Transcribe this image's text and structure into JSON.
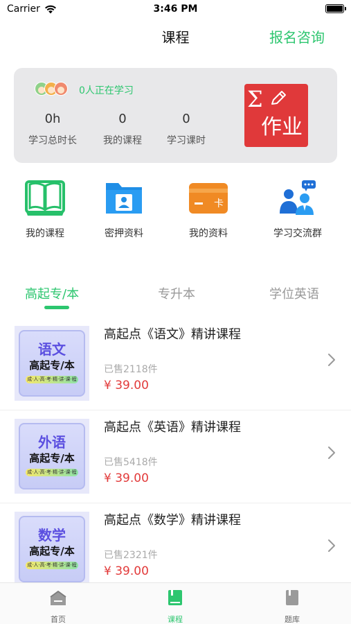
{
  "status_bar": {
    "carrier": "Carrier",
    "time": "3:46 PM"
  },
  "nav": {
    "title": "课程",
    "action": "报名咨询"
  },
  "stats_card": {
    "learning_now": "0人正在学习",
    "stats": [
      {
        "value": "0h",
        "label": "学习总时长"
      },
      {
        "value": "0",
        "label": "我的课程"
      },
      {
        "value": "0",
        "label": "学习课时"
      }
    ],
    "homework_label": "作业",
    "homework_symbol": "Σ"
  },
  "quick_menu": [
    {
      "label": "我的课程",
      "icon": "book-icon"
    },
    {
      "label": "密押资料",
      "icon": "folder-user-icon"
    },
    {
      "label": "我的资料",
      "icon": "card-icon"
    },
    {
      "label": "学习交流群",
      "icon": "group-chat-icon"
    }
  ],
  "tabs": [
    {
      "label": "高起专/本",
      "active": true
    },
    {
      "label": "专升本",
      "active": false
    },
    {
      "label": "学位英语",
      "active": false
    }
  ],
  "courses": [
    {
      "cover_subject": "语文",
      "cover_level": "高起专/本",
      "cover_strip": "成·人·高·考·精·讲·课·程",
      "title": "高起点《语文》精讲课程",
      "sold": "已售2118件",
      "price": "¥ 39.00"
    },
    {
      "cover_subject": "外语",
      "cover_level": "高起专/本",
      "cover_strip": "成·人·高·考·精·讲·课·程",
      "title": "高起点《英语》精讲课程",
      "sold": "已售5418件",
      "price": "¥ 39.00"
    },
    {
      "cover_subject": "数学",
      "cover_level": "高起专/本",
      "cover_strip": "成·人·高·考·精·讲·课·程",
      "title": "高起点《数学》精讲课程",
      "sold": "已售2321件",
      "price": "¥ 39.00"
    }
  ],
  "tabbar": [
    {
      "label": "首页",
      "icon": "home-icon",
      "active": false
    },
    {
      "label": "课程",
      "icon": "course-book-icon",
      "active": true
    },
    {
      "label": "题库",
      "icon": "question-bank-icon",
      "active": false
    }
  ],
  "colors": {
    "accent": "#2dc66f",
    "homework": "#e0393a",
    "price": "#e23a3a",
    "card_bg": "#e8e8ea"
  }
}
